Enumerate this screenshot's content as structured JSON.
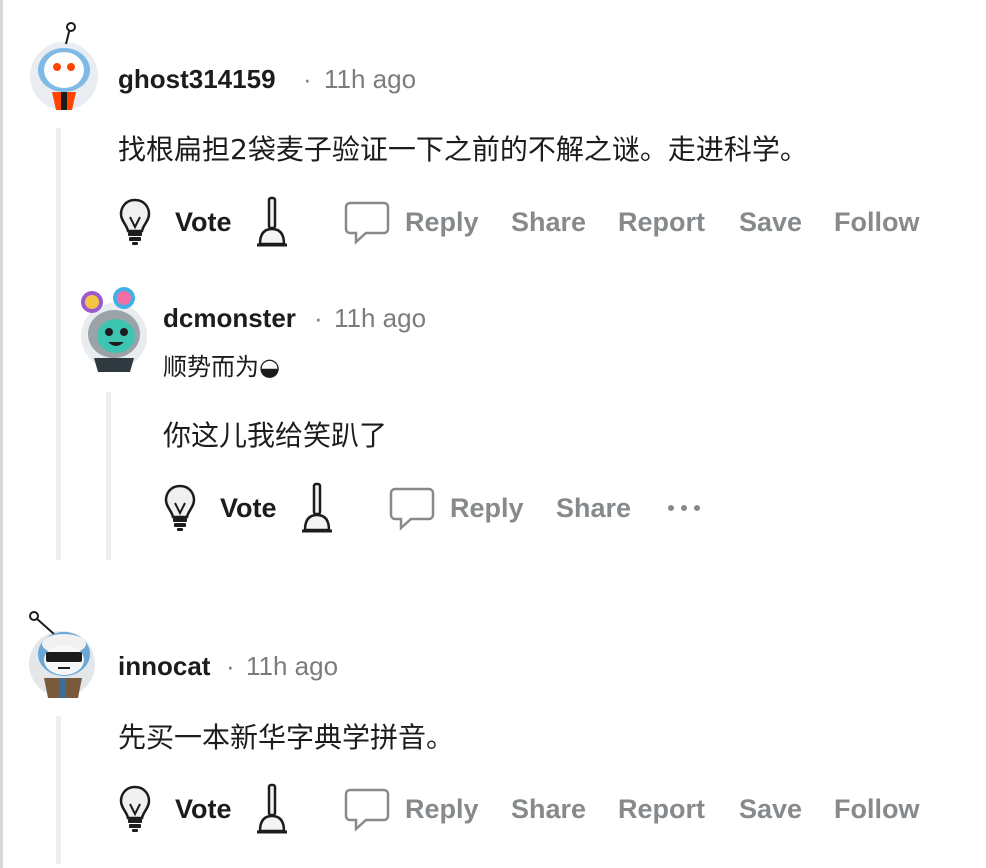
{
  "comments": [
    {
      "username": "ghost314159",
      "separator": "·",
      "time": "11h ago",
      "body": "找根扁担2袋麦子验证一下之前的不解之谜。走进科学。",
      "actions": {
        "vote": "Vote",
        "reply": "Reply",
        "share": "Share",
        "report": "Report",
        "save": "Save",
        "follow": "Follow"
      },
      "replies": [
        {
          "username": "dcmonster",
          "separator": "·",
          "time": "11h ago",
          "flair": "顺势而为◒",
          "body": "你这儿我给笑趴了",
          "actions": {
            "vote": "Vote",
            "reply": "Reply",
            "share": "Share"
          }
        }
      ]
    },
    {
      "username": "innocat",
      "separator": "·",
      "time": "11h ago",
      "body": "先买一本新华字典学拼音。",
      "actions": {
        "vote": "Vote",
        "reply": "Reply",
        "share": "Share",
        "report": "Report",
        "save": "Save",
        "follow": "Follow"
      }
    }
  ],
  "icons": {
    "vote_up": "lightbulb-upvote-icon",
    "vote_down": "plunger-downvote-icon",
    "reply": "speech-bubble-icon",
    "more": "more-options-icon"
  },
  "colors": {
    "muted": "#878a8c",
    "text": "#1c1c1c",
    "thread_line": "#edeff1",
    "avatar_ghost_bg": "#dae0e6",
    "avatar_dc_bg": "#4fbdba",
    "avatar_innocat_bg": "#e4e7ea"
  }
}
